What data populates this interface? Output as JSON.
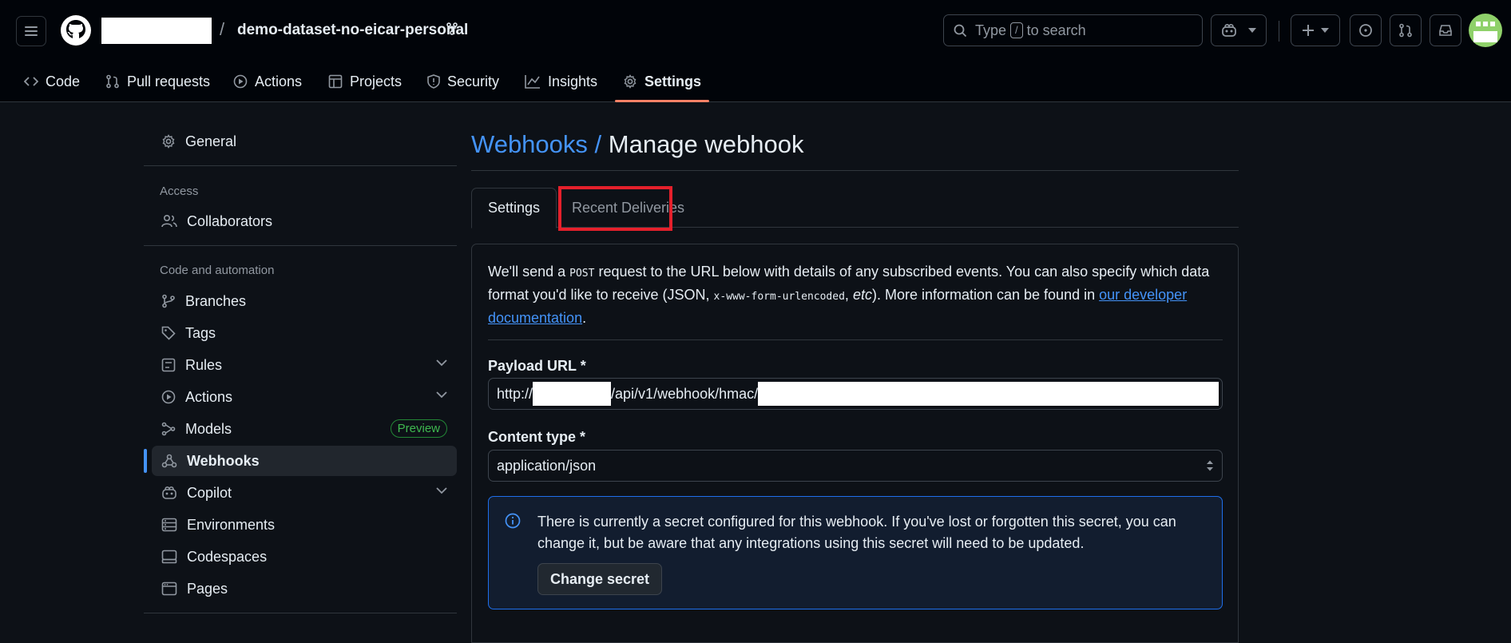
{
  "header": {
    "repo_name": "demo-dataset-no-eicar-personal",
    "slash": "/",
    "search": {
      "prefix": "Type",
      "key": "/",
      "suffix": "to search"
    }
  },
  "nav_tabs": [
    {
      "label": "Code",
      "icon": "code-icon"
    },
    {
      "label": "Pull requests",
      "icon": "pull-request-icon"
    },
    {
      "label": "Actions",
      "icon": "play-icon"
    },
    {
      "label": "Projects",
      "icon": "table-icon"
    },
    {
      "label": "Security",
      "icon": "shield-icon"
    },
    {
      "label": "Insights",
      "icon": "graph-icon"
    },
    {
      "label": "Settings",
      "icon": "gear-icon",
      "active": true
    }
  ],
  "sidebar": {
    "general": "General",
    "access_heading": "Access",
    "collaborators": "Collaborators",
    "code_heading": "Code and automation",
    "items": [
      {
        "label": "Branches",
        "icon": "branch-icon"
      },
      {
        "label": "Tags",
        "icon": "tag-icon"
      },
      {
        "label": "Rules",
        "icon": "rules-icon"
      },
      {
        "label": "Actions",
        "icon": "play-icon"
      },
      {
        "label": "Models",
        "icon": "models-icon",
        "badge": "Preview"
      },
      {
        "label": "Webhooks",
        "icon": "webhook-icon",
        "active": true
      },
      {
        "label": "Copilot",
        "icon": "copilot-icon"
      },
      {
        "label": "Environments",
        "icon": "server-icon"
      },
      {
        "label": "Codespaces",
        "icon": "codespaces-icon"
      },
      {
        "label": "Pages",
        "icon": "browser-icon"
      }
    ]
  },
  "main": {
    "crumb": "Webhooks /",
    "title": "Manage webhook",
    "tabs": [
      "Settings",
      "Recent Deliveries"
    ],
    "intro": {
      "t1": "We'll send a ",
      "code1": "POST",
      "t2": " request to the URL below with details of any subscribed events. You can also specify which data format you'd like to receive (JSON, ",
      "code2": "x-www-form-urlencoded",
      "t3": ", ",
      "etc": "etc",
      "t4": "). More information can be found in ",
      "link": "our developer documentation",
      "t5": "."
    },
    "payload_label": "Payload URL *",
    "payload": {
      "prefix": "http://",
      "middle": "/api/v1/webhook/hmac/"
    },
    "content_type_label": "Content type *",
    "content_type": "application/json",
    "notice": "There is currently a secret configured for this webhook. If you've lost or forgotten this secret, you can change it, but be aware that any integrations using this secret will need to be updated.",
    "change_secret": "Change secret"
  },
  "colors": {
    "accent": "#4493f8",
    "active_tab": "#f78166",
    "highlight": "#e5202b",
    "success": "#3fb950"
  }
}
